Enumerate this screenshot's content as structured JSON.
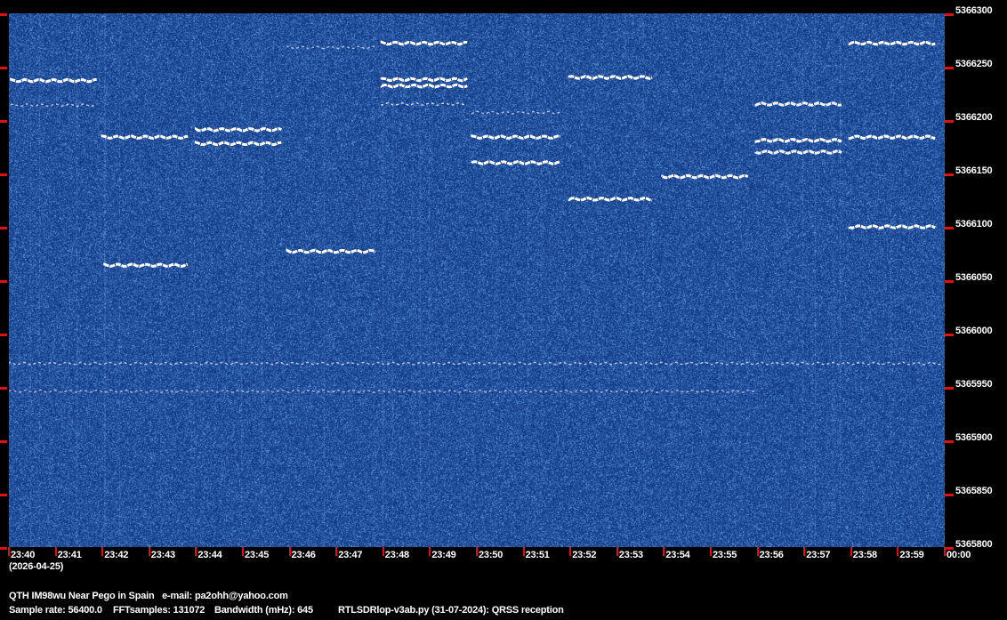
{
  "chart_data": {
    "type": "heatmap",
    "subtype": "waterfall spectrogram",
    "x_ticks": [
      "23:40",
      "23:41",
      "23:42",
      "23:43",
      "23:44",
      "23:45",
      "23:46",
      "23:47",
      "23:48",
      "23:49",
      "23:50",
      "23:51",
      "23:52",
      "23:53",
      "23:54",
      "23:55",
      "23:56",
      "23:57",
      "23:58",
      "23:59",
      "00:00"
    ],
    "y_ticks": [
      "5366300",
      "5366250",
      "5366200",
      "5366150",
      "5366100",
      "5366050",
      "5366000",
      "5365950",
      "5365900",
      "5365850",
      "5365800"
    ],
    "ylim": [
      5365800,
      5366300
    ],
    "xlim_minutes": [
      0,
      20
    ],
    "date": "(2026-04-25)",
    "colors": {
      "background": "#1c4a8c",
      "signal": "#ffffff",
      "tick": "#e01010"
    },
    "traces": [
      {
        "t0": 0.05,
        "t1": 1.9,
        "f": 5366237,
        "strength": 1
      },
      {
        "t0": 0.05,
        "t1": 1.9,
        "f": 5366214,
        "strength": 0.4
      },
      {
        "t0": 2.0,
        "t1": 3.85,
        "f": 5366184,
        "strength": 1
      },
      {
        "t0": 2.05,
        "t1": 3.85,
        "f": 5366064,
        "strength": 1
      },
      {
        "t0": 4.0,
        "t1": 5.85,
        "f": 5366191,
        "strength": 1
      },
      {
        "t0": 4.0,
        "t1": 5.85,
        "f": 5366178,
        "strength": 1
      },
      {
        "t0": 5.95,
        "t1": 7.85,
        "f": 5366077,
        "strength": 1
      },
      {
        "t0": 5.95,
        "t1": 7.85,
        "f": 5366268,
        "strength": 0.35
      },
      {
        "t0": 7.97,
        "t1": 9.8,
        "f": 5366272,
        "strength": 1
      },
      {
        "t0": 7.97,
        "t1": 9.8,
        "f": 5366238,
        "strength": 1
      },
      {
        "t0": 7.97,
        "t1": 9.8,
        "f": 5366232,
        "strength": 1
      },
      {
        "t0": 7.97,
        "t1": 9.8,
        "f": 5366215,
        "strength": 0.6
      },
      {
        "t0": 9.9,
        "t1": 11.8,
        "f": 5366184,
        "strength": 1
      },
      {
        "t0": 9.9,
        "t1": 11.8,
        "f": 5366160,
        "strength": 1
      },
      {
        "t0": 9.9,
        "t1": 11.8,
        "f": 5366207,
        "strength": 0.4
      },
      {
        "t0": 11.98,
        "t1": 13.8,
        "f": 5366240,
        "strength": 1
      },
      {
        "t0": 11.98,
        "t1": 13.8,
        "f": 5366126,
        "strength": 1
      },
      {
        "t0": 13.97,
        "t1": 15.85,
        "f": 5366147,
        "strength": 1
      },
      {
        "t0": 15.97,
        "t1": 17.8,
        "f": 5366215,
        "strength": 0.9
      },
      {
        "t0": 15.97,
        "t1": 17.8,
        "f": 5366181,
        "strength": 1
      },
      {
        "t0": 15.97,
        "t1": 17.8,
        "f": 5366170,
        "strength": 0.9
      },
      {
        "t0": 17.97,
        "t1": 19.85,
        "f": 5366272,
        "strength": 1
      },
      {
        "t0": 17.97,
        "t1": 19.85,
        "f": 5366184,
        "strength": 1
      },
      {
        "t0": 17.97,
        "t1": 19.85,
        "f": 5366100,
        "strength": 1
      },
      {
        "t0": 0.0,
        "t1": 20.0,
        "f": 5365972,
        "strength": 0.45
      },
      {
        "t0": 0.0,
        "t1": 16.0,
        "f": 5365946,
        "strength": 0.3
      }
    ]
  },
  "footer": {
    "qth": "QTH IM98wu Near Pego in Spain   e-mail: pa2ohh@yahoo.com",
    "sample_rate": "Sample rate: 56400.0",
    "fft": "FFTsamples: 131072",
    "bandwidth": "Bandwidth (mHz): 645",
    "program": "RTLSDRlop-v3ab.py (31-07-2024): QRSS reception"
  }
}
